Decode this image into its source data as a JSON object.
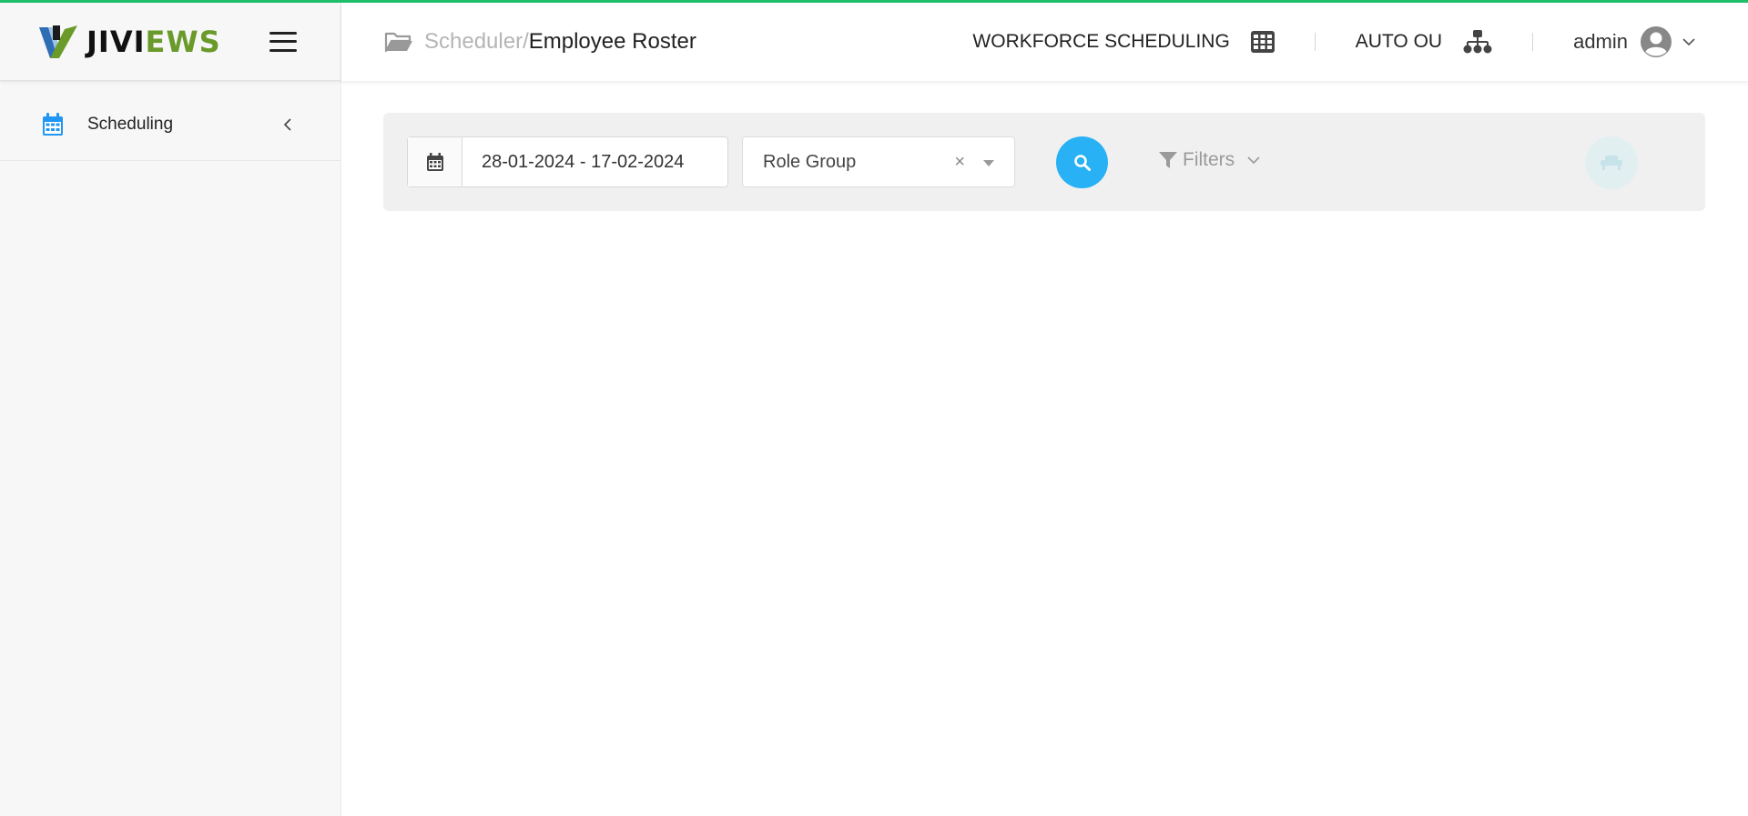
{
  "colors": {
    "accent": "#29b1f5",
    "topline": "#1fbf6a",
    "brand_green": "#6a9a2a"
  },
  "brand": {
    "name_part1": "JIVI",
    "name_part2": "EWS",
    "logo_icon": "jiviews-logo-icon"
  },
  "sidebar": {
    "items": [
      {
        "label": "Scheduling",
        "icon": "calendar-icon",
        "chevron": "chevron-left-icon"
      }
    ]
  },
  "header": {
    "breadcrumb": {
      "parent": "Scheduler/",
      "current": "Employee Roster",
      "icon": "folder-open-icon"
    },
    "module": {
      "label": "WORKFORCE SCHEDULING",
      "icon": "grid-icon"
    },
    "ou": {
      "label": "AUTO OU",
      "icon": "org-chart-icon"
    },
    "user": {
      "name": "admin",
      "icon": "user-circle-icon",
      "caret": "chevron-down-icon"
    }
  },
  "filter_panel": {
    "date_range": {
      "value": "28-01-2024 - 17-02-2024",
      "icon": "calendar-icon"
    },
    "role_group": {
      "value": "Role Group",
      "clear": "×"
    },
    "search_button": {
      "icon": "search-icon"
    },
    "filters": {
      "label": "Filters",
      "icon": "filter-icon"
    },
    "extra_button": {
      "icon": "sofa-icon"
    }
  }
}
